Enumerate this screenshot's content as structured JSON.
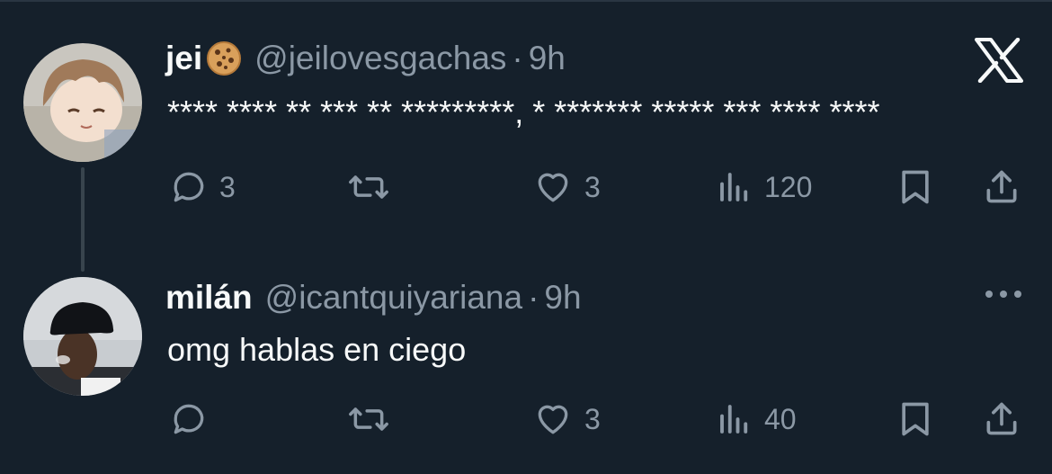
{
  "tweets": [
    {
      "display_name": "jei",
      "emoji_icon": "cookie-icon",
      "handle": "@jeilovesgachas",
      "separator": "·",
      "time": "9h",
      "text": "**** **** ** *** ** *********, * ******* ***** *** **** ****",
      "actions": {
        "replies": "3",
        "retweets": "",
        "likes": "3",
        "views": "120"
      },
      "corner_icon": "x-logo-icon"
    },
    {
      "display_name": "milán",
      "handle": "@icantquiyariana",
      "separator": "·",
      "time": "9h",
      "text": "omg hablas en ciego",
      "actions": {
        "replies": "",
        "retweets": "",
        "likes": "3",
        "views": "40"
      },
      "corner_icon": "more-options-icon"
    }
  ],
  "colors": {
    "background": "#15202b",
    "primary_text": "#f7f9f9",
    "secondary_text": "#8b98a5",
    "thread_line": "#38444d"
  }
}
